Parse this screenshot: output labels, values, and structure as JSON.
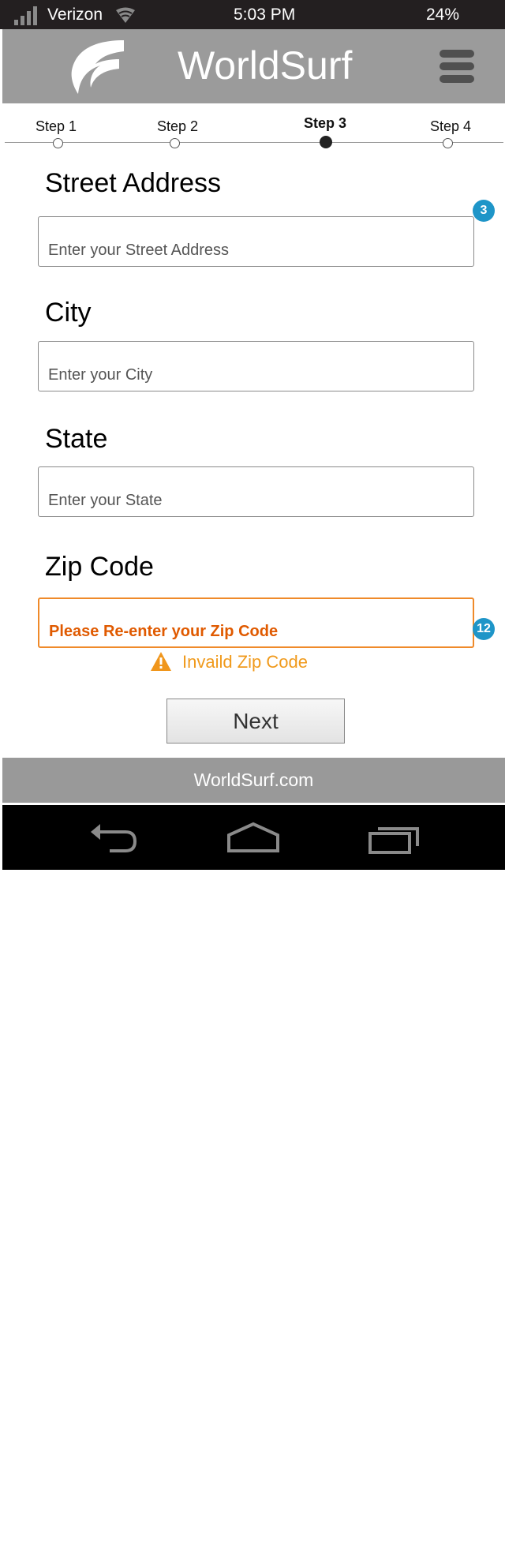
{
  "status_bar": {
    "carrier": "Verizon",
    "time": "5:03 PM",
    "battery": "24%"
  },
  "header": {
    "title": "WorldSurf",
    "logo_icon": "worldsurf-logo-icon",
    "menu_icon": "hamburger-menu-icon"
  },
  "stepper": {
    "steps": [
      {
        "label": "Step 1",
        "active": false
      },
      {
        "label": "Step 2",
        "active": false
      },
      {
        "label": "Step 3",
        "active": true
      },
      {
        "label": "Step 4",
        "active": false
      }
    ]
  },
  "form": {
    "street": {
      "label": "Street Address",
      "placeholder": "Enter your Street Address",
      "value": "",
      "badge": "3"
    },
    "city": {
      "label": "City",
      "placeholder": "Enter your City",
      "value": ""
    },
    "state": {
      "label": "State",
      "placeholder": "Enter your State",
      "value": ""
    },
    "zip": {
      "label": "Zip Code",
      "placeholder": "Please Re-enter your Zip Code",
      "value": "",
      "badge": "12",
      "error": "Invaild Zip Code"
    },
    "next_label": "Next"
  },
  "footer": {
    "site": "WorldSurf.com"
  },
  "nav_bar": {
    "icons": [
      "back-icon",
      "home-icon",
      "recent-apps-icon"
    ]
  },
  "colors": {
    "header_bg": "#9b9b9b",
    "error": "#ef8a2a",
    "badge": "#1e95c8"
  }
}
